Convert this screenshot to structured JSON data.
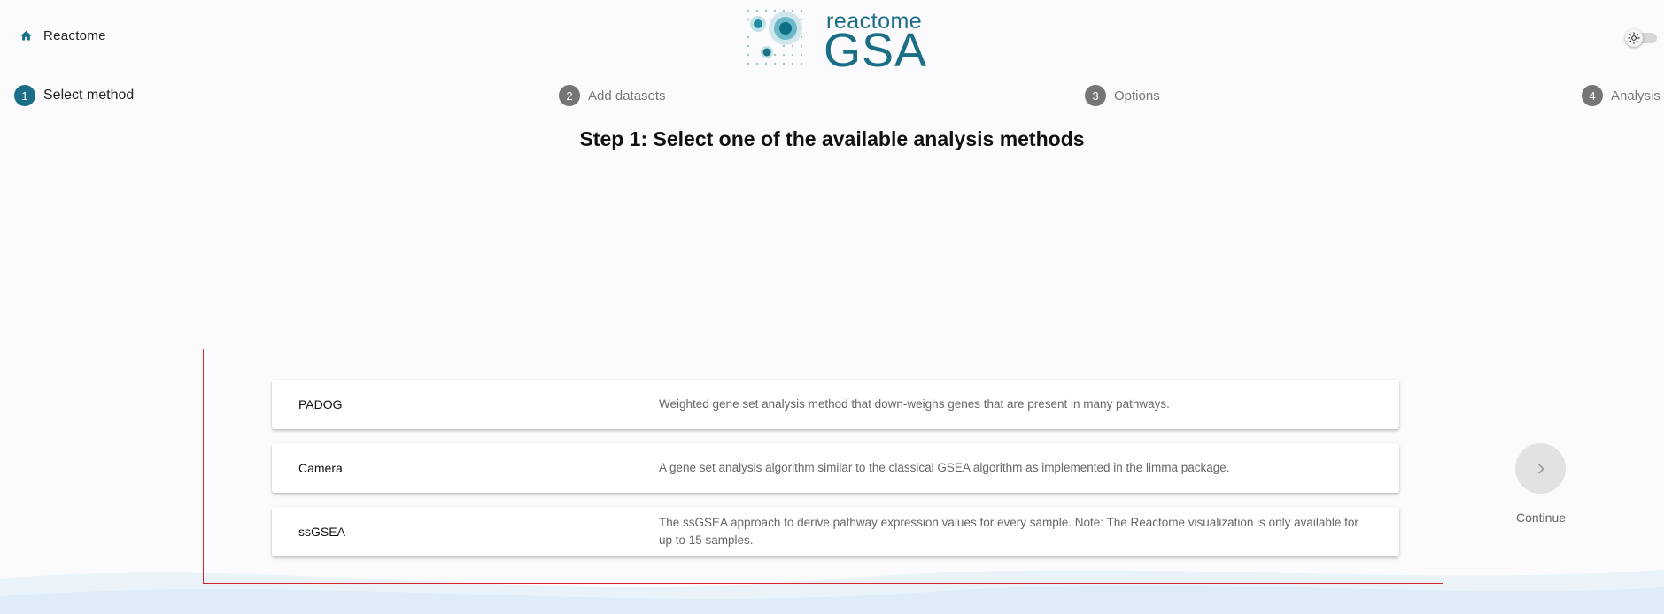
{
  "header": {
    "home_label": "Reactome",
    "logo_small": "reactome",
    "logo_big": "GSA"
  },
  "stepper": {
    "steps": [
      {
        "number": "1",
        "label": "Select method",
        "state": "active"
      },
      {
        "number": "2",
        "label": "Add datasets",
        "state": "inactive"
      },
      {
        "number": "3",
        "label": "Options",
        "state": "inactive"
      },
      {
        "number": "4",
        "label": "Analysis",
        "state": "inactive"
      }
    ]
  },
  "main": {
    "title": "Step 1: Select one of the available analysis methods",
    "methods": [
      {
        "name": "PADOG",
        "description": "Weighted gene set analysis method that down-weighs genes that are present in many pathways."
      },
      {
        "name": "Camera",
        "description": "A gene set analysis algorithm similar to the classical GSEA algorithm as implemented in the limma package."
      },
      {
        "name": "ssGSEA",
        "description": "The ssGSEA approach to derive pathway expression values for every sample. Note: The Reactome visualization is only available for up to 15 samples."
      }
    ],
    "continue_label": "Continue"
  },
  "colors": {
    "brand": "#1a6e85",
    "highlight_border": "#d6252b",
    "inactive_step": "#757575"
  },
  "icons": {
    "home": "home-icon",
    "theme": "sun-icon",
    "continue": "chevron-right-icon"
  }
}
